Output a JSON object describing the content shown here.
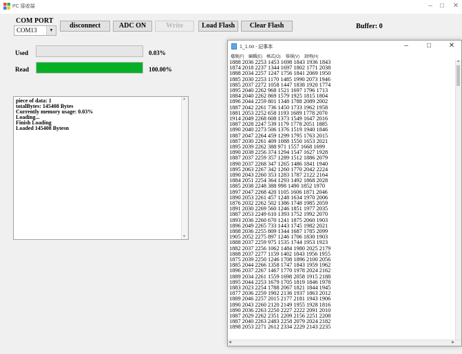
{
  "window": {
    "title": "PC 接收端",
    "minimize": "–",
    "maximize": "□",
    "close": "✕"
  },
  "port": {
    "label": "COM PORT",
    "selected": "COM13"
  },
  "buttons": {
    "disconnect": "disconnect",
    "adc_on": "ADC ON",
    "write": "Write",
    "load_flash": "Load Flash",
    "clear_flash": "Clear Flash"
  },
  "buffer": "Buffer: 0",
  "used": {
    "label": "Used",
    "fraction": 0.0003,
    "percent_text": "0.03%"
  },
  "read": {
    "label": "Read",
    "fraction": 1.0,
    "percent_text": "100.00%"
  },
  "log_lines": [
    "piece of data: 1",
    "totalBytes: 145408 Bytes",
    "Currently memory usage: 0.03%",
    "Loading...",
    "Finish Loading",
    "Loaded 145408 Bytesn"
  ],
  "notepad": {
    "title": "1_1.txt - 記事本",
    "menu": [
      "檔案(F)",
      "編輯(E)",
      "格式(O)",
      "檢視(V)",
      "說明(H)"
    ],
    "lines": [
      "1888 2036 2253 1453 1698 1843 1936 1843",
      "1874 2018 2237 1344 1697 1802 1771 2038",
      "1888 2034 2257 1247 1756 1841 2069 1950",
      "1885 2030 2253 1170 1485 1990 2073 1946",
      "1885 2037 2272 1058 1447 1838 1920 1774",
      "1895 2040 2262 968 1521 1697 1796 1713",
      "1884 2040 2262 869 1579 1925 1815 1804",
      "1896 2044 2259 801 1348 1788 2089 2002",
      "1887 2042 2261 736 1450 1733 1962 1958",
      "1881 2053 2252 658 1193 1689 1778 2070",
      "1914 2049 2268 608 1373 1549 1647 2016",
      "1887 2028 2247 539 1179 1778 2051 1885",
      "1890 2040 2273 506 1376 1519 1940 1846",
      "1887 2047 2264 459 1299 1795 1763 2015",
      "1887 2030 2261 409 1088 1550 1653 2021",
      "1895 2039 2262 388 971 1557 1668 1699",
      "1890 2038 2256 374 1294 1547 1627 1928",
      "1887 2037 2259 357 1289 1512 1886 2079",
      "1890 2037 2268 347 1265 1486 1841 1940",
      "1895 2063 2267 342 1260 1770 2042 2224",
      "1890 2043 2260 353 1283 1787 2122 2164",
      "1884 2051 2254 364 1293 1492 1868 2028",
      "1885 2038 2248 388 998 1490 1852 1970",
      "1897 2047 2268 420 1105 1606 1871 2046",
      "1890 2053 2261 457 1248 1634 1970 2006",
      "1876 2032 2262 502 1386 1748 1985 2059",
      "1891 2030 2269 560 1246 1851 1977 2035",
      "1887 2053 2249 610 1393 1752 1992 2070",
      "1893 2036 2260 670 1241 1875 2060 1903",
      "1896 2049 2265 733 1443 1745 1982 2021",
      "1888 2036 2255 809 1344 1687 1785 2099",
      "1905 2052 2275 897 1246 1706 1830 1903",
      "1888 2037 2259 975 1535 1744 1953 1923",
      "1882 2037 2256 1062 1484 1980 2025 2179",
      "1888 2037 2277 1159 1402 1843 1956 1955",
      "1875 2039 2250 1246 1708 1896 2100 2056",
      "1885 2044 2266 1358 1747 1843 1959 1962",
      "1896 2037 2267 1467 1770 1978 2024 2162",
      "1889 2034 2261 1559 1698 2058 1915 2188",
      "1895 2044 2253 1679 1705 1819 1846 1978",
      "1883 2023 2254 1788 2067 1821 1844 1945",
      "1877 2036 2259 1902 2136 1937 1863 2012",
      "1889 2046 2257 2015 2177 2181 1943 1906",
      "1890 2043 2260 2120 2149 1955 1928 1816",
      "1890 2036 2263 2250 2227 2222 2091 2010",
      "1887 2029 2262 2351 2209 2156 2251 2208",
      "1887 2040 2263 2483 2258 2079 2024 2182",
      "1898 2053 2271 2612 2334 2229 2143 2235"
    ]
  },
  "colors": {
    "progress_fill": "#06b025",
    "progress_track": "#e6e6e6",
    "window_bg": "#f0f0f0"
  },
  "icons": {
    "app": "app-icon",
    "notepad": "notepad-icon"
  }
}
